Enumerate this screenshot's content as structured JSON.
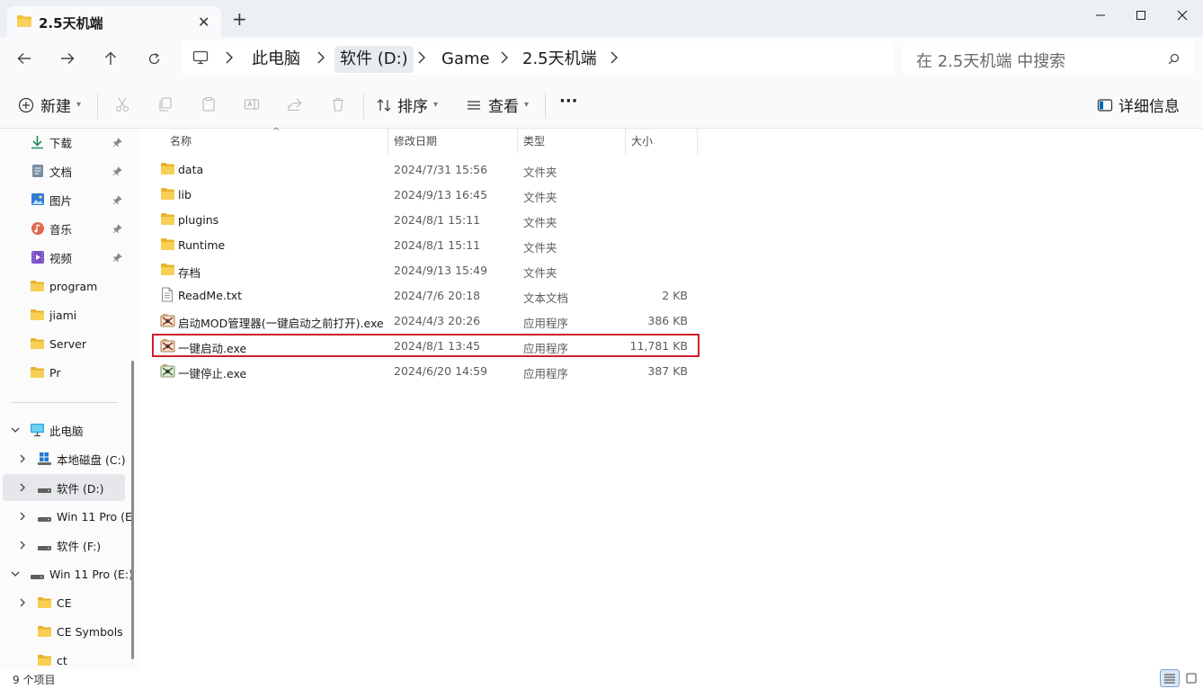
{
  "window": {
    "tab_title": "2.5天机端",
    "new_tab_symbol": "+",
    "close_tab_symbol": "✕"
  },
  "address": {
    "breadcrumbs": [
      "此电脑",
      "软件 (D:)",
      "Game",
      "2.5天机端"
    ],
    "search_placeholder": "在 2.5天机端 中搜索"
  },
  "toolbar": {
    "new_label": "新建",
    "sort_label": "排序",
    "view_label": "查看",
    "more_label": "···",
    "details_label": "详细信息"
  },
  "sidebar": {
    "quick_access": [
      {
        "label": "下载",
        "icon": "download-icon",
        "pinned": true
      },
      {
        "label": "文档",
        "icon": "document-icon",
        "pinned": true
      },
      {
        "label": "图片",
        "icon": "picture-icon",
        "pinned": true
      },
      {
        "label": "音乐",
        "icon": "music-icon",
        "pinned": true
      },
      {
        "label": "视频",
        "icon": "video-icon",
        "pinned": true
      },
      {
        "label": "program",
        "icon": "folder-icon"
      },
      {
        "label": "jiami",
        "icon": "folder-icon"
      },
      {
        "label": "Server",
        "icon": "folder-icon"
      },
      {
        "label": "Pr",
        "icon": "folder-icon"
      }
    ],
    "tree": [
      {
        "label": "此电脑",
        "icon": "computer-icon",
        "expanded": true
      },
      {
        "label": "本地磁盘 (C:)",
        "icon": "windows-drive-icon"
      },
      {
        "label": "软件 (D:)",
        "icon": "drive-icon",
        "selected": true
      },
      {
        "label": "Win 11 Pro (E",
        "icon": "drive-icon"
      },
      {
        "label": "软件 (F:)",
        "icon": "drive-icon"
      },
      {
        "label": "Win 11 Pro (E:)",
        "icon": "drive-icon",
        "expanded": true
      },
      {
        "label": "CE",
        "icon": "folder-icon"
      },
      {
        "label": "CE Symbols",
        "icon": "folder-icon"
      },
      {
        "label": "ct",
        "icon": "folder-icon"
      }
    ]
  },
  "columns": {
    "name": "名称",
    "date": "修改日期",
    "type": "类型",
    "size": "大小"
  },
  "files": [
    {
      "name": "data",
      "date": "2024/7/31 15:56",
      "type": "文件夹",
      "size": "",
      "icon": "folder-icon"
    },
    {
      "name": "lib",
      "date": "2024/9/13 16:45",
      "type": "文件夹",
      "size": "",
      "icon": "folder-icon"
    },
    {
      "name": "plugins",
      "date": "2024/8/1 15:11",
      "type": "文件夹",
      "size": "",
      "icon": "folder-icon"
    },
    {
      "name": "Runtime",
      "date": "2024/8/1 15:11",
      "type": "文件夹",
      "size": "",
      "icon": "folder-icon"
    },
    {
      "name": "存档",
      "date": "2024/9/13 15:49",
      "type": "文件夹",
      "size": "",
      "icon": "folder-icon"
    },
    {
      "name": "ReadMe.txt",
      "date": "2024/7/6 20:18",
      "type": "文本文档",
      "size": "2 KB",
      "icon": "text-file-icon"
    },
    {
      "name": "启动MOD管理器(一键启动之前打开).exe",
      "date": "2024/4/3 20:26",
      "type": "应用程序",
      "size": "386 KB",
      "icon": "exe-icon"
    },
    {
      "name": "一键启动.exe",
      "date": "2024/8/1 13:45",
      "type": "应用程序",
      "size": "11,781 KB",
      "icon": "exe-icon",
      "highlighted": true
    },
    {
      "name": "一键停止.exe",
      "date": "2024/6/20 14:59",
      "type": "应用程序",
      "size": "387 KB",
      "icon": "exe-icon"
    }
  ],
  "status": {
    "item_count": "9 个项目"
  },
  "colors": {
    "highlight_border": "#d0202a",
    "folder": "#f3c13a",
    "accent": "#0067c0"
  }
}
